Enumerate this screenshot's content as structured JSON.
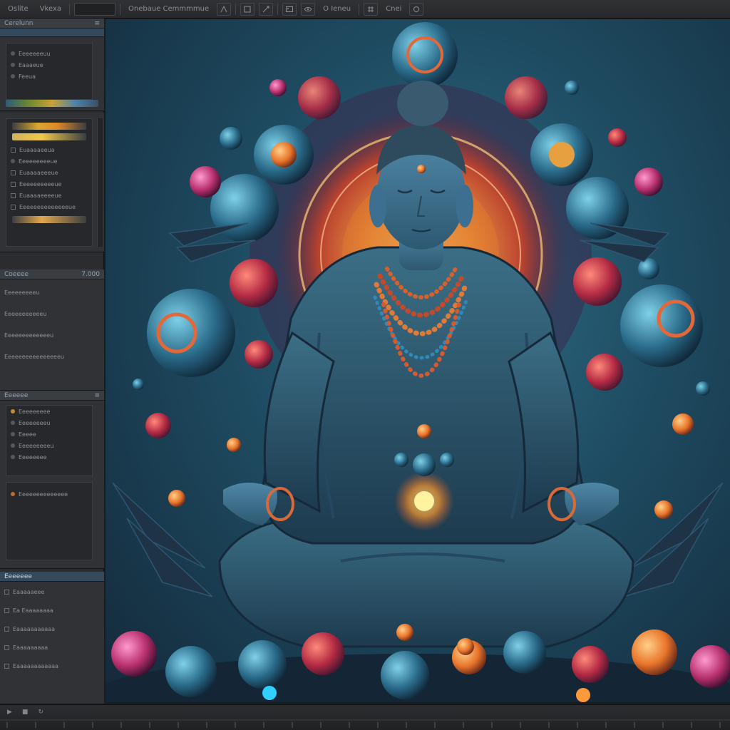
{
  "app": {
    "menu": [
      "Oslite",
      "Vkexa"
    ],
    "toolbar_field_a": "Onebaue Cemmmmue",
    "toolbar_field_b": "O Ieneu",
    "toolbar_field_c": "Cnei"
  },
  "left_panel": {
    "layers_header": "Cerelunn",
    "layers": [
      "Eeeeeeeuu",
      "Eaaaeue",
      "Feeua"
    ],
    "gradient_header": "",
    "gradient_items": [
      "Euaaaaeeua",
      "Eeeeeeeeeue",
      "Euaaaaeeeue",
      "Eeeeeeeeeeue",
      "Euaaaaeeeeue",
      "Eeeeeeeeeeeeeeue"
    ],
    "props_header": "Coeeee",
    "props_value": "7.000",
    "props_items": [
      "Eeeeeeeeeu",
      "Eeeeeeeeeeeu",
      "Eeeeeeeeeeeeeu",
      "Eeeeeeeeeeeeeeeeu"
    ],
    "tree_header": "Eeeeee",
    "tree_items": [
      "Eeeeeeeee",
      "Eeeeeeeeu",
      "Eeeee",
      "Eeeeeeeeeu",
      "Eeeeeeee",
      "Eeeeeeeeeeeeee"
    ],
    "outliner_header": "Eeeeeee",
    "outliner_items": [
      "Eaaaaaeee",
      "Ea Eaaaaaaaa",
      "Eaaaaaaaaaaa",
      "Eaaaaaaaaa",
      "Eaaaaaaaaaaaa"
    ]
  },
  "canvas": {
    "artwork": "meditating figure render"
  },
  "colors": {
    "bg": "#1b1c1e",
    "panel": "#303235",
    "accent_blue": "#34495c",
    "glow_orange": "#ff9a3a"
  }
}
